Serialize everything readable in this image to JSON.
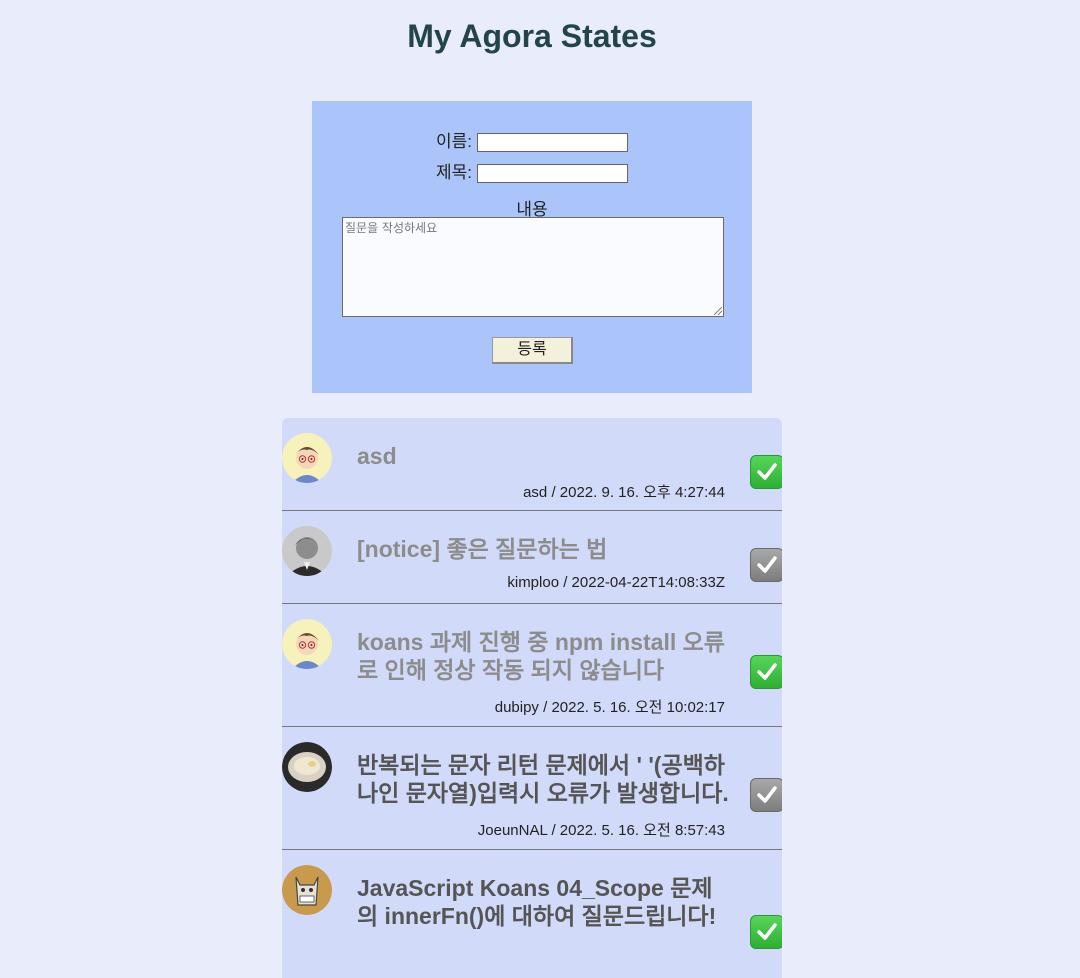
{
  "page": {
    "title": "My Agora States"
  },
  "form": {
    "name_label": "이름:",
    "title_label": "제목:",
    "content_label": "내용",
    "content_placeholder": "질문을 작성하세요",
    "submit_label": "등록"
  },
  "discussions": [
    {
      "title": "asd",
      "meta": "asd / 2022. 9. 16. 오후 4:27:44",
      "answered": true,
      "avatar": "cartoon-boy-avatar"
    },
    {
      "title": "[notice] 좋은 질문하는 법",
      "meta": "kimploo / 2022-04-22T14:08:33Z",
      "answered": false,
      "avatar": "photo-man-avatar"
    },
    {
      "title": "koans 과제 진행 중 npm install 오류로 인해 정상 작동 되지 않습니다",
      "meta": "dubipy / 2022. 5. 16. 오전 10:02:17",
      "answered": true,
      "avatar": "cartoon-boy-avatar"
    },
    {
      "title": "반복되는 문자 리턴 문제에서 ' '(공백하나인 문자열)입력시 오류가 발생합니다.",
      "meta": "JoeunNAL / 2022. 5. 16. 오전 8:57:43",
      "answered": false,
      "avatar": "bowl-photo-avatar"
    },
    {
      "title": "JavaScript Koans 04_Scope 문제의 innerFn()에 대하여 질문드립니다!",
      "meta": "",
      "answered": true,
      "avatar": "cat-illustration-avatar"
    }
  ],
  "colors": {
    "background": "#e8ecfb",
    "form_bg": "#abc5fb",
    "list_bg": "#d2daf9",
    "check_green": "#3cc241"
  }
}
